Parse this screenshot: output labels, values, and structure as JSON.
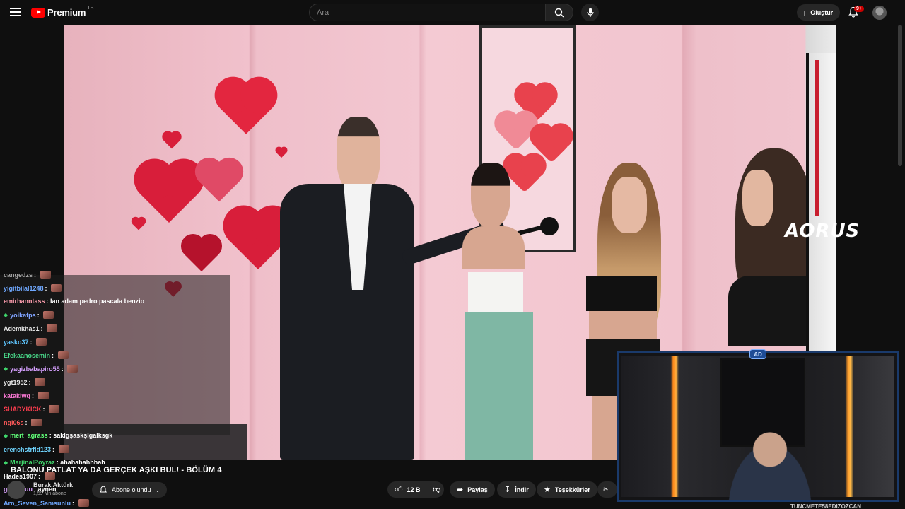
{
  "header": {
    "brand": "Premium",
    "region": "TR",
    "search_placeholder": "Ara",
    "create_label": "Oluştur",
    "notification_badge": "9+"
  },
  "overlay": {
    "sponsor_logo": "AORUS"
  },
  "chat": {
    "messages": [
      {
        "user": "cangedzs",
        "color": "#a7a7a7",
        "msg": "",
        "emote": true,
        "badge": false
      },
      {
        "user": "yigitbilal1248",
        "color": "#6fa8ff",
        "msg": "",
        "emote": true,
        "badge": false
      },
      {
        "user": "emirhanntass",
        "color": "#ff9fb0",
        "msg": "lan adam pedro pascala benzio",
        "emote": false,
        "badge": false
      },
      {
        "user": "yoikafps",
        "color": "#7fa3ff",
        "msg": "",
        "emote": true,
        "badge": true
      },
      {
        "user": "Ademkhas1",
        "color": "#e8e8e8",
        "msg": "",
        "emote": true,
        "badge": false
      },
      {
        "user": "yasko37",
        "color": "#5fc6ff",
        "msg": "",
        "emote": true,
        "badge": false
      },
      {
        "user": "Efekaanosemin",
        "color": "#49d98a",
        "msg": "",
        "emote": true,
        "badge": false
      },
      {
        "user": "yagizbabapiro55",
        "color": "#d6a0ff",
        "msg": "",
        "emote": true,
        "badge": true
      },
      {
        "user": "ygt1952",
        "color": "#e8e8e8",
        "msg": "",
        "emote": true,
        "badge": false
      },
      {
        "user": "katakiwq",
        "color": "#ff7ad8",
        "msg": "",
        "emote": true,
        "badge": false
      },
      {
        "user": "SHADYKICK",
        "color": "#ff3d4f",
        "msg": "",
        "emote": true,
        "badge": false
      },
      {
        "user": "ngl06s",
        "color": "#ff5a5a",
        "msg": "",
        "emote": true,
        "badge": false
      },
      {
        "user": "mert_agrass",
        "color": "#62ff7a",
        "msg": "saklgşaskşlgalksgk",
        "emote": false,
        "badge": true
      },
      {
        "user": "erenchstrfld123",
        "color": "#6fd5ff",
        "msg": "",
        "emote": true,
        "badge": false
      },
      {
        "user": "MarjinalPoyraz",
        "color": "#3fd56b",
        "msg": "ahahahahhhah",
        "emote": false,
        "badge": true
      },
      {
        "user": "Hades1907",
        "color": "#ffffff",
        "msg": "",
        "emote": true,
        "badge": false
      },
      {
        "user": "ganryuuu",
        "color": "#d9a0ff",
        "msg": "aynen",
        "emote": false,
        "badge": false
      },
      {
        "user": "Arn_Seven_Samsunlu",
        "color": "#6fa8ff",
        "msg": "",
        "emote": true,
        "badge": false
      }
    ]
  },
  "video": {
    "title": "BALONU PATLAT YA DA GERÇEK AŞKI BUL! - BÖLÜM 4",
    "channel": "Burak Aktürk",
    "subscribers": "1,59 Mn abone",
    "subscribed_label": "Abone olundu",
    "like_count": "12 B",
    "share_label": "Paylaş",
    "download_label": "İndir",
    "thanks_label": "Teşekkürler"
  },
  "webcam": {
    "label": "TUNCMETE58EDIZOZCAN",
    "emblem": "AD"
  },
  "colors": {
    "accent": "#ff0000",
    "background": "#0f0f0f",
    "button_bg": "#272727"
  }
}
